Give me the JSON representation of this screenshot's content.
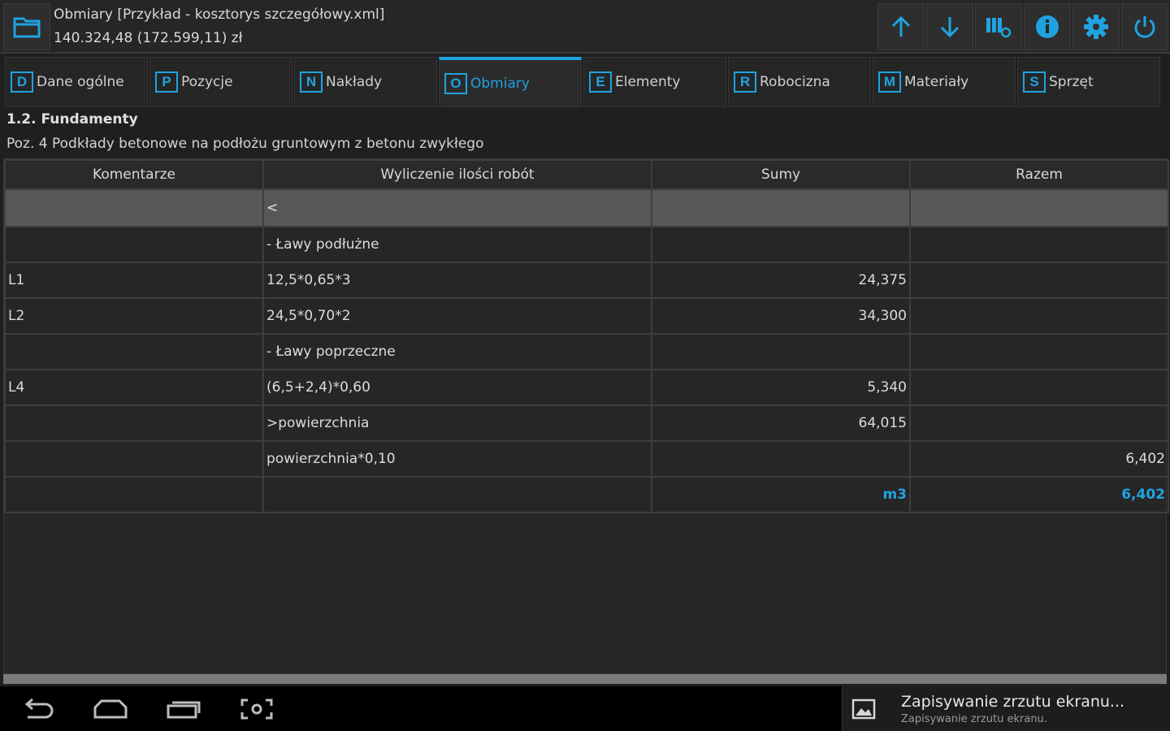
{
  "header": {
    "title": "Obmiary [Przykład - kosztorys szczegółowy.xml]",
    "subtitle": "140.324,48 (172.599,11) zł",
    "folder_icon": "folder-icon",
    "toolbar": [
      {
        "name": "move-up-button",
        "icon": "arrow-up-icon"
      },
      {
        "name": "move-down-button",
        "icon": "arrow-down-icon"
      },
      {
        "name": "catalog-settings-button",
        "icon": "columns-settings-icon"
      },
      {
        "name": "info-button",
        "icon": "info-icon"
      },
      {
        "name": "settings-button",
        "icon": "gear-icon"
      },
      {
        "name": "power-button",
        "icon": "power-icon"
      }
    ],
    "accent_color": "#1fa3e0"
  },
  "tabs": [
    {
      "key": "D",
      "label": "Dane ogólne"
    },
    {
      "key": "P",
      "label": "Pozycje"
    },
    {
      "key": "N",
      "label": "Nakłady"
    },
    {
      "key": "O",
      "label": "Obmiary",
      "active": true
    },
    {
      "key": "E",
      "label": "Elementy"
    },
    {
      "key": "R",
      "label": "Robocizna"
    },
    {
      "key": "M",
      "label": "Materiały"
    },
    {
      "key": "S",
      "label": "Sprzęt"
    }
  ],
  "section": {
    "title": "1.2. Fundamenty",
    "position": "Poz. 4 Podkłady betonowe na podłożu gruntowym z betonu zwykłego"
  },
  "table": {
    "columns": [
      "Komentarze",
      "Wyliczenie ilości robót",
      "Sumy",
      "Razem"
    ],
    "back_row": "<",
    "rows": [
      [
        "",
        "- Ławy podłużne",
        "",
        ""
      ],
      [
        "L1",
        "12,5*0,65*3",
        "24,375",
        ""
      ],
      [
        "L2",
        "24,5*0,70*2",
        "34,300",
        ""
      ],
      [
        "",
        "- Ławy poprzeczne",
        "",
        ""
      ],
      [
        "L4",
        "(6,5+2,4)*0,60",
        "5,340",
        ""
      ],
      [
        "",
        ">powierzchnia",
        "64,015",
        ""
      ],
      [
        "",
        "powierzchnia*0,10",
        "",
        "6,402"
      ],
      [
        "",
        "",
        "m3",
        "6,402"
      ]
    ]
  },
  "navbar": {
    "buttons": [
      "back-icon",
      "home-icon",
      "recent-apps-icon",
      "screenshot-icon"
    ]
  },
  "notification": {
    "title": "Zapisywanie zrzutu ekranu...",
    "subtitle": "Zapisywanie zrzutu ekranu.",
    "icon": "image-icon"
  }
}
